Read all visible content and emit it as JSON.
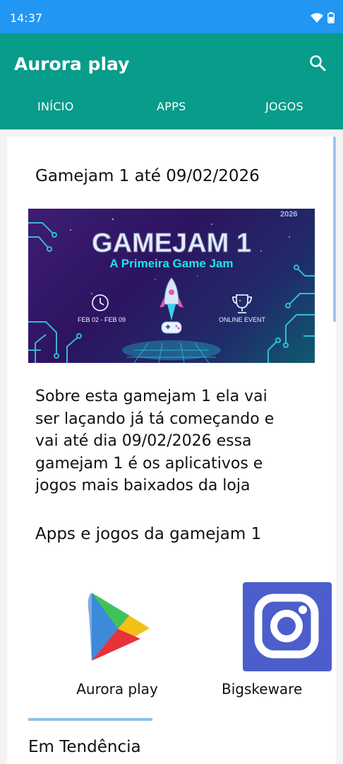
{
  "status_bar": {
    "time": "14:37"
  },
  "app_bar": {
    "title": "Aurora play",
    "tabs": [
      "INÍCIO",
      "APPS",
      "JOGOS"
    ]
  },
  "post": {
    "title": "Gamejam 1 até 09/02/2026",
    "banner": {
      "year": "2026",
      "headline": "GAMEJAM 1",
      "subtitle": "A Primeira Game Jam",
      "dates": "FEB 02 - FEB 09",
      "event_type": "ONLINE EVENT"
    },
    "body": "Sobre esta gamejam 1 ela vai ser laçando já tá começando e vai até dia 09/02/2026 essa gamejam 1 é os aplicativos e jogos mais baixados da loja"
  },
  "apps_section": {
    "title": "Apps e jogos da gamejam 1",
    "apps": [
      {
        "name": "Aurora play",
        "icon": "play-store-icon"
      },
      {
        "name": "Bigskeware",
        "icon": "instagram-style-icon"
      }
    ]
  },
  "trending": {
    "title": "Em Tendência"
  },
  "colors": {
    "status_bar": "#2196f3",
    "app_bar": "#089c8a",
    "divider": "#8ec1ea"
  }
}
